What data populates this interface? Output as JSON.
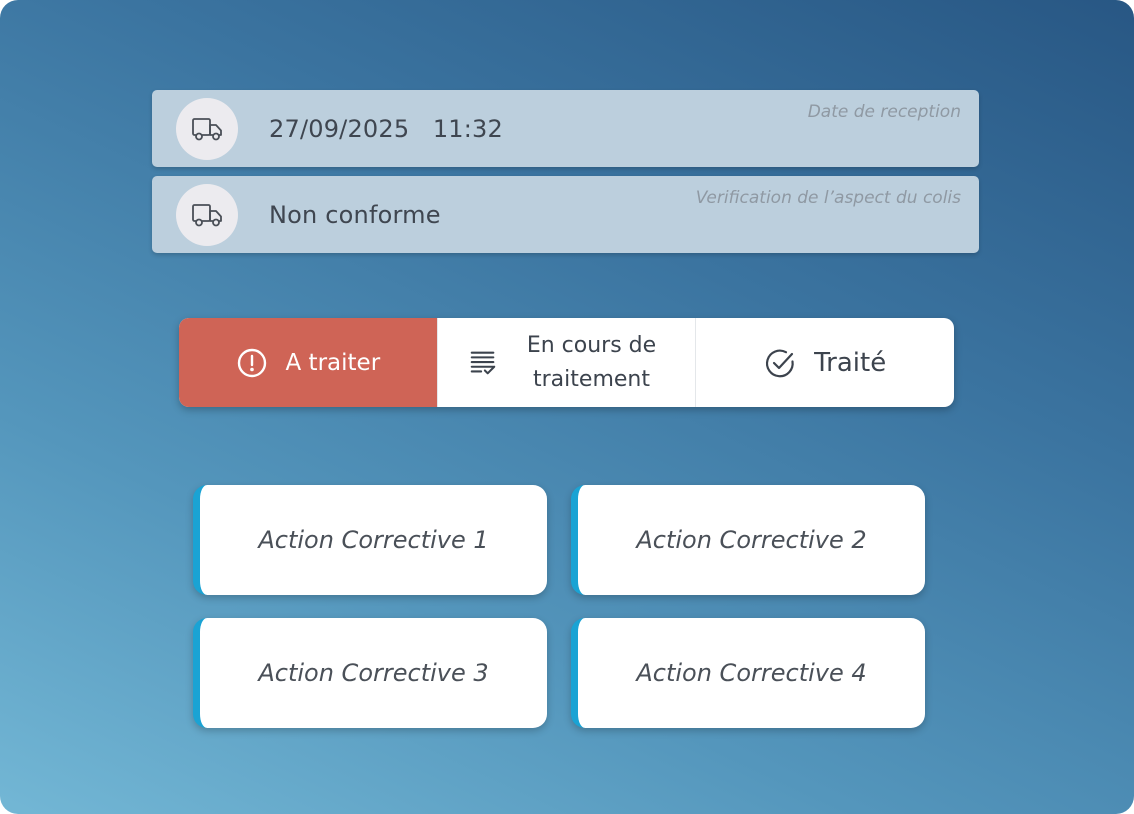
{
  "reception": {
    "icon": "truck-icon",
    "value": "27/09/2025   11:32",
    "label": "Date de reception"
  },
  "package_check": {
    "icon": "truck-icon",
    "value": "Non conforme",
    "label": "Verification de l’aspect du colis"
  },
  "status": {
    "selected": "A traiter",
    "active_color": "#cf6456",
    "options": [
      {
        "label": "A traiter",
        "icon": "alert-circle-icon"
      },
      {
        "label": "En cours de traitement",
        "icon": "checklist-icon"
      },
      {
        "label": "Traité",
        "icon": "check-circle-icon"
      }
    ]
  },
  "actions": {
    "accent_color": "#1aa3d4",
    "items": [
      {
        "label": "Action Corrective 1"
      },
      {
        "label": "Action Corrective 2"
      },
      {
        "label": "Action Corrective 3"
      },
      {
        "label": "Action Corrective 4"
      }
    ]
  }
}
